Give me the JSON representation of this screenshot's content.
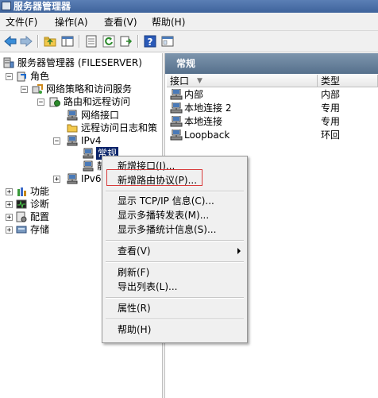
{
  "window": {
    "title": "服务器管理器"
  },
  "menubar": {
    "items": [
      "文件(F)",
      "操作(A)",
      "查看(V)",
      "帮助(H)"
    ]
  },
  "toolbar": {
    "icons": [
      "back-icon",
      "forward-icon",
      "up-folder-icon",
      "show-tree-icon",
      "properties-icon",
      "refresh-icon",
      "export-icon",
      "help-icon",
      "console-icon"
    ]
  },
  "tree": {
    "root": "服务器管理器 (FILESERVER)",
    "roles": "角色",
    "npas": "网络策略和访问服务",
    "rras": "路由和远程访问",
    "interfaces": "网络接口",
    "remote_log": "远程访问日志和策",
    "ipv4": "IPv4",
    "general": "常规",
    "ipv4_child2": "静",
    "ipv6": "IPv6",
    "features": "功能",
    "diagnostics": "诊断",
    "configuration": "配置",
    "storage": "存储"
  },
  "details": {
    "header": "常规",
    "columns": [
      "接口",
      "类型"
    ],
    "sort_indicator": "▼",
    "rows": [
      {
        "name": "内部",
        "type": "内部"
      },
      {
        "name": "本地连接 2",
        "type": "专用"
      },
      {
        "name": "本地连接",
        "type": "专用"
      },
      {
        "name": "Loopback",
        "type": "环回"
      }
    ]
  },
  "context_menu": {
    "items": [
      "新增接口(I)...",
      "新增路由协议(P)...",
      "显示 TCP/IP 信息(C)...",
      "显示多播转发表(M)...",
      "显示多播统计信息(S)...",
      "查看(V)",
      "刷新(F)",
      "导出列表(L)...",
      "属性(R)",
      "帮助(H)"
    ],
    "highlighted_item": "新增路由协议(P)..."
  },
  "colors": {
    "highlight_box": "#d83a3a",
    "selection": "#0a246a",
    "header": "#6a839f"
  }
}
